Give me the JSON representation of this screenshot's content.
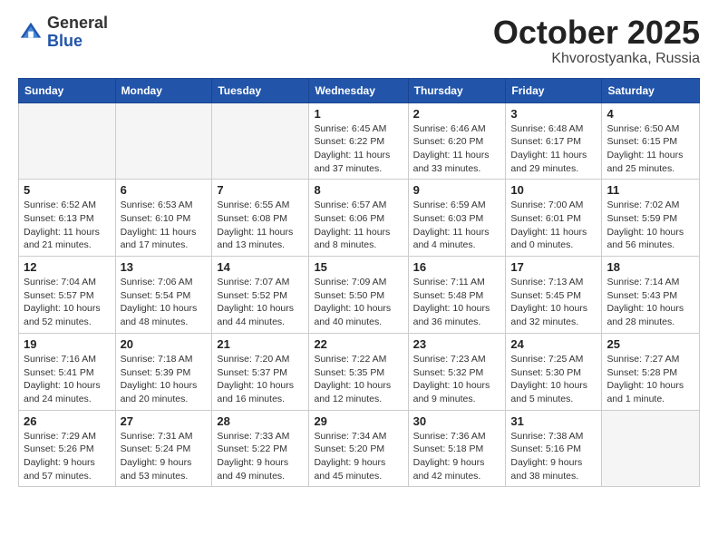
{
  "header": {
    "logo_general": "General",
    "logo_blue": "Blue",
    "month": "October 2025",
    "location": "Khvorostyanka, Russia"
  },
  "weekdays": [
    "Sunday",
    "Monday",
    "Tuesday",
    "Wednesday",
    "Thursday",
    "Friday",
    "Saturday"
  ],
  "weeks": [
    [
      {
        "day": "",
        "info": ""
      },
      {
        "day": "",
        "info": ""
      },
      {
        "day": "",
        "info": ""
      },
      {
        "day": "1",
        "info": "Sunrise: 6:45 AM\nSunset: 6:22 PM\nDaylight: 11 hours\nand 37 minutes."
      },
      {
        "day": "2",
        "info": "Sunrise: 6:46 AM\nSunset: 6:20 PM\nDaylight: 11 hours\nand 33 minutes."
      },
      {
        "day": "3",
        "info": "Sunrise: 6:48 AM\nSunset: 6:17 PM\nDaylight: 11 hours\nand 29 minutes."
      },
      {
        "day": "4",
        "info": "Sunrise: 6:50 AM\nSunset: 6:15 PM\nDaylight: 11 hours\nand 25 minutes."
      }
    ],
    [
      {
        "day": "5",
        "info": "Sunrise: 6:52 AM\nSunset: 6:13 PM\nDaylight: 11 hours\nand 21 minutes."
      },
      {
        "day": "6",
        "info": "Sunrise: 6:53 AM\nSunset: 6:10 PM\nDaylight: 11 hours\nand 17 minutes."
      },
      {
        "day": "7",
        "info": "Sunrise: 6:55 AM\nSunset: 6:08 PM\nDaylight: 11 hours\nand 13 minutes."
      },
      {
        "day": "8",
        "info": "Sunrise: 6:57 AM\nSunset: 6:06 PM\nDaylight: 11 hours\nand 8 minutes."
      },
      {
        "day": "9",
        "info": "Sunrise: 6:59 AM\nSunset: 6:03 PM\nDaylight: 11 hours\nand 4 minutes."
      },
      {
        "day": "10",
        "info": "Sunrise: 7:00 AM\nSunset: 6:01 PM\nDaylight: 11 hours\nand 0 minutes."
      },
      {
        "day": "11",
        "info": "Sunrise: 7:02 AM\nSunset: 5:59 PM\nDaylight: 10 hours\nand 56 minutes."
      }
    ],
    [
      {
        "day": "12",
        "info": "Sunrise: 7:04 AM\nSunset: 5:57 PM\nDaylight: 10 hours\nand 52 minutes."
      },
      {
        "day": "13",
        "info": "Sunrise: 7:06 AM\nSunset: 5:54 PM\nDaylight: 10 hours\nand 48 minutes."
      },
      {
        "day": "14",
        "info": "Sunrise: 7:07 AM\nSunset: 5:52 PM\nDaylight: 10 hours\nand 44 minutes."
      },
      {
        "day": "15",
        "info": "Sunrise: 7:09 AM\nSunset: 5:50 PM\nDaylight: 10 hours\nand 40 minutes."
      },
      {
        "day": "16",
        "info": "Sunrise: 7:11 AM\nSunset: 5:48 PM\nDaylight: 10 hours\nand 36 minutes."
      },
      {
        "day": "17",
        "info": "Sunrise: 7:13 AM\nSunset: 5:45 PM\nDaylight: 10 hours\nand 32 minutes."
      },
      {
        "day": "18",
        "info": "Sunrise: 7:14 AM\nSunset: 5:43 PM\nDaylight: 10 hours\nand 28 minutes."
      }
    ],
    [
      {
        "day": "19",
        "info": "Sunrise: 7:16 AM\nSunset: 5:41 PM\nDaylight: 10 hours\nand 24 minutes."
      },
      {
        "day": "20",
        "info": "Sunrise: 7:18 AM\nSunset: 5:39 PM\nDaylight: 10 hours\nand 20 minutes."
      },
      {
        "day": "21",
        "info": "Sunrise: 7:20 AM\nSunset: 5:37 PM\nDaylight: 10 hours\nand 16 minutes."
      },
      {
        "day": "22",
        "info": "Sunrise: 7:22 AM\nSunset: 5:35 PM\nDaylight: 10 hours\nand 12 minutes."
      },
      {
        "day": "23",
        "info": "Sunrise: 7:23 AM\nSunset: 5:32 PM\nDaylight: 10 hours\nand 9 minutes."
      },
      {
        "day": "24",
        "info": "Sunrise: 7:25 AM\nSunset: 5:30 PM\nDaylight: 10 hours\nand 5 minutes."
      },
      {
        "day": "25",
        "info": "Sunrise: 7:27 AM\nSunset: 5:28 PM\nDaylight: 10 hours\nand 1 minute."
      }
    ],
    [
      {
        "day": "26",
        "info": "Sunrise: 7:29 AM\nSunset: 5:26 PM\nDaylight: 9 hours\nand 57 minutes."
      },
      {
        "day": "27",
        "info": "Sunrise: 7:31 AM\nSunset: 5:24 PM\nDaylight: 9 hours\nand 53 minutes."
      },
      {
        "day": "28",
        "info": "Sunrise: 7:33 AM\nSunset: 5:22 PM\nDaylight: 9 hours\nand 49 minutes."
      },
      {
        "day": "29",
        "info": "Sunrise: 7:34 AM\nSunset: 5:20 PM\nDaylight: 9 hours\nand 45 minutes."
      },
      {
        "day": "30",
        "info": "Sunrise: 7:36 AM\nSunset: 5:18 PM\nDaylight: 9 hours\nand 42 minutes."
      },
      {
        "day": "31",
        "info": "Sunrise: 7:38 AM\nSunset: 5:16 PM\nDaylight: 9 hours\nand 38 minutes."
      },
      {
        "day": "",
        "info": ""
      }
    ]
  ]
}
